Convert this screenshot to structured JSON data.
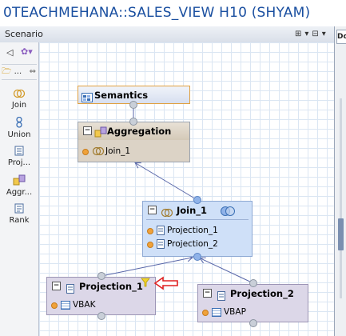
{
  "window": {
    "title": "0TEACHMEHANA::SALES_VIEW H10 (SHYAM)"
  },
  "scenario": {
    "label": "Scenario",
    "right_tab": "Do"
  },
  "palette": {
    "folder_label": "...",
    "tools": [
      {
        "label": "Join",
        "icon": "join-icon"
      },
      {
        "label": "Union",
        "icon": "union-icon"
      },
      {
        "label": "Proj...",
        "icon": "projection-icon"
      },
      {
        "label": "Aggr...",
        "icon": "aggregation-icon"
      },
      {
        "label": "Rank",
        "icon": "rank-icon"
      }
    ]
  },
  "nodes": {
    "semantics": {
      "title": "Semantics"
    },
    "aggregation": {
      "title": "Aggregation",
      "input": "Join_1"
    },
    "join": {
      "title": "Join_1",
      "inputs": [
        "Projection_1",
        "Projection_2"
      ]
    },
    "projection1": {
      "title": "Projection_1",
      "table": "VBAK"
    },
    "projection2": {
      "title": "Projection_2",
      "table": "VBAP"
    }
  },
  "colors": {
    "title_text": "#1a4fa0",
    "semantics_bg": "#e3e8f5",
    "aggregation_bg": "#dcd3c6",
    "join_bg": "#cfe0f8",
    "projection_bg": "#dcd7e8",
    "highlight_arrow": "#e02020"
  }
}
